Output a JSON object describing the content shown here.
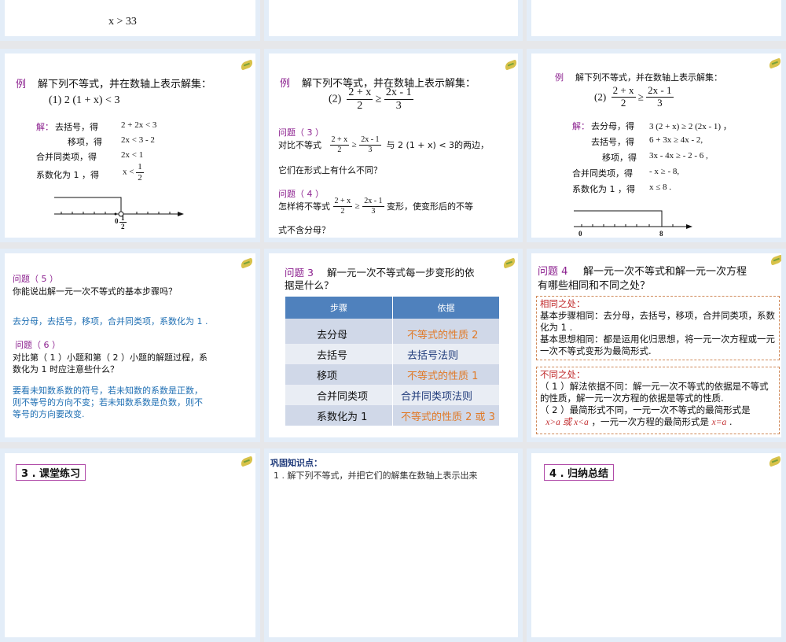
{
  "slides": {
    "top1": {
      "result": "x > 33"
    },
    "s1": {
      "title_tag": "例",
      "title": "解下列不等式，并在数轴上表示解集：",
      "problem": "(1)   2 (1 + x) < 3",
      "solve_label": "解：",
      "steps": [
        {
          "label": "去括号，得",
          "expr": "2 + 2x < 3"
        },
        {
          "label": "移项，得",
          "expr": "2x < 3 - 2"
        },
        {
          "label": "合并同类项，得",
          "expr": "2x < 1"
        },
        {
          "label": "系数化为 1 ，得",
          "expr": "x <"
        }
      ],
      "final_num": "1",
      "final_den": "2",
      "axis_zero": "0",
      "axis_num": "1",
      "axis_den": "2"
    },
    "s2": {
      "title_tag": "例",
      "title": "解下列不等式，并在数轴上表示解集：",
      "problem_label": "(2)",
      "lhs_num": "2 + x",
      "lhs_den": "2",
      "rel": "≥",
      "rhs_num": "2x - 1",
      "rhs_den": "3",
      "q3_title": "问题（ 3 ）",
      "q3_prefix": "对比不等式",
      "q3_mid": "与  2 (1 + x) < 3的两边，",
      "q3_line2": "它们在形式上有什么不同？",
      "q4_title": "问题（ 4 ）",
      "q4_prefix": "怎样将不等式",
      "q4_suffix": "变形，使变形后的不等",
      "q4_line2": "式不含分母？"
    },
    "s3": {
      "title_tag": "例",
      "title": "解下列不等式，并在数轴上表示解集：",
      "problem_label": "(2)",
      "lhs_num": "2 + x",
      "lhs_den": "2",
      "rel": "≥",
      "rhs_num": "2x - 1",
      "rhs_den": "3",
      "solve_label": "解：",
      "steps": [
        {
          "label": "去分母，得",
          "expr": "3 (2 + x) ≥ 2 (2x - 1) ，"
        },
        {
          "label": "去括号，得",
          "expr": "6 + 3x ≥ 4x - 2,"
        },
        {
          "label": "移项，得",
          "expr": "3x - 4x ≥ - 2 - 6 ,"
        },
        {
          "label": "合并同类项，得",
          "expr": "- x ≥ - 8,"
        },
        {
          "label": "系数化为 1 ，得",
          "expr": "x ≤ 8 ."
        }
      ],
      "axis_zero": "0",
      "axis_eight": "8"
    },
    "s4": {
      "q5_title": "问题（ 5 ）",
      "q5_text": "你能说出解一元一次不等式的基本步骤吗？",
      "q5_answer": "去分母，去括号，移项，合并同类项，系数化为 1 .",
      "q6_title": "问题（ 6 ）",
      "q6_line1": "对比第（ 1 ）小题和第（ 2 ）小题的解题过程，系",
      "q6_line2": "数化为 1 时应注意些什么？",
      "q6_answer": [
        "要看未知数系数的符号，若未知数的系数是正数，",
        "则不等号的方向不变；若未知数系数是负数，则不",
        "等号的方向要改变."
      ]
    },
    "s5": {
      "title_tag": "问题 3",
      "title_line1": "解一元一次不等式每一步变形的依",
      "title_line2": "据是什么？",
      "headers": [
        "步骤",
        "依据"
      ],
      "rows": [
        {
          "step": "去分母",
          "basis": "不等式的性质 2",
          "color": "orange"
        },
        {
          "step": "去括号",
          "basis": "去括号法则",
          "color": "navy"
        },
        {
          "step": "移项",
          "basis": "不等式的性质 1",
          "color": "orange"
        },
        {
          "step": "合并同类项",
          "basis": "合并同类项法则",
          "color": "navy"
        },
        {
          "step": "系数化为 1",
          "basis": "不等式的性质 2 或 3",
          "color": "orange"
        }
      ]
    },
    "s6": {
      "title_tag": "问题 4",
      "title_line1": "解一元一次不等式和解一元一次方程",
      "title_line2": "有哪些相同和不同之处？",
      "same_title": "相同之处：",
      "same_text1": "基本步骤相同：去分母，去括号，移项，合并同类项，系数化为 1 .",
      "same_text2": "基本思想相同：都是运用化归思想，将一元一次方程或一元一次不等式变形为最简形式.",
      "diff_title": "不同之处：",
      "diff_text1": "（ 1 ）解法依据不同：解一元一次不等式的依据是不等式的性质，解一元一次方程的依据是等式的性质.",
      "diff_text2": "（ 2 ）最简形式不同，一元一次不等式的最简形式是",
      "form1": "x>a 或 x<a",
      "diff_mid": " ，一元一次方程的最简形式是 ",
      "form2": "x=a",
      "diff_end": " ."
    },
    "b1": {
      "tag": "3 . 课堂练习"
    },
    "b2": {
      "title": "巩固知识点：",
      "line": "1 . 解下列不等式，并把它们的解集在数轴上表示出来"
    },
    "b3": {
      "tag": "4 . 归纳总结"
    }
  }
}
